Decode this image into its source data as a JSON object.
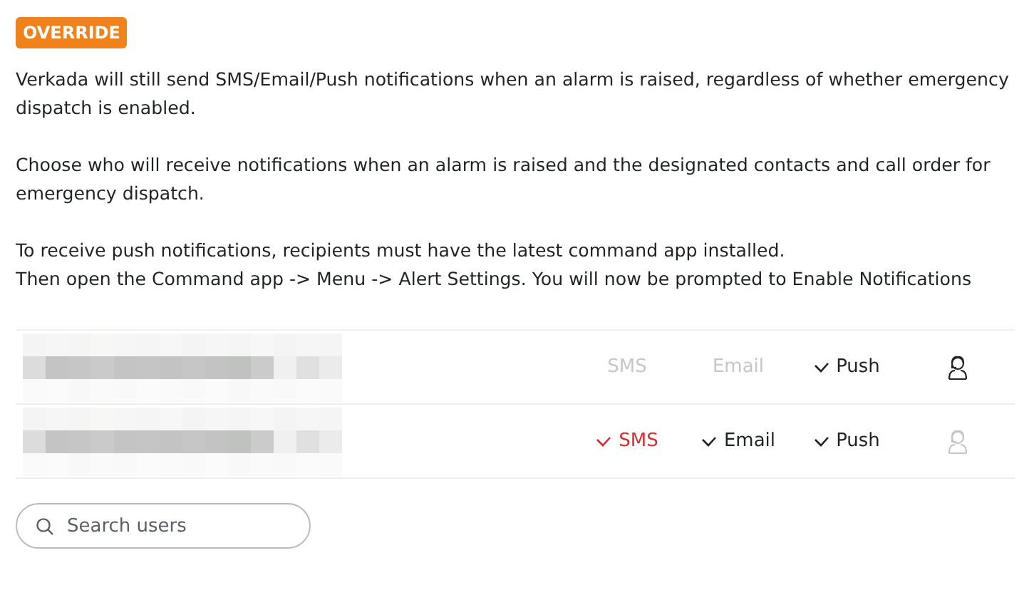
{
  "badge": "OVERRIDE",
  "paragraphs": [
    [
      "Verkada will still send SMS/Email/Push notifications when an alarm is raised, regardless of whether emergency dispatch is enabled."
    ],
    [
      "Choose who will receive notifications when an alarm is raised and the designated contacts and call order for emergency dispatch."
    ],
    [
      "To receive push notifications, recipients must have the latest command app installed.",
      "Then open the Command app -> Menu -> Alert Settings. You will now be prompted to Enable Notifications"
    ]
  ],
  "recipients": [
    {
      "channels": [
        {
          "kind": "sms",
          "label": "SMS",
          "checked": false
        },
        {
          "kind": "email",
          "label": "Email",
          "checked": false
        },
        {
          "kind": "push",
          "label": "Push",
          "checked": true
        }
      ],
      "dispatch_contact": true
    },
    {
      "channels": [
        {
          "kind": "sms",
          "label": "SMS",
          "checked": true
        },
        {
          "kind": "email",
          "label": "Email",
          "checked": true
        },
        {
          "kind": "push",
          "label": "Push",
          "checked": true
        }
      ],
      "dispatch_contact": false
    }
  ],
  "search": {
    "placeholder": "Search users"
  }
}
